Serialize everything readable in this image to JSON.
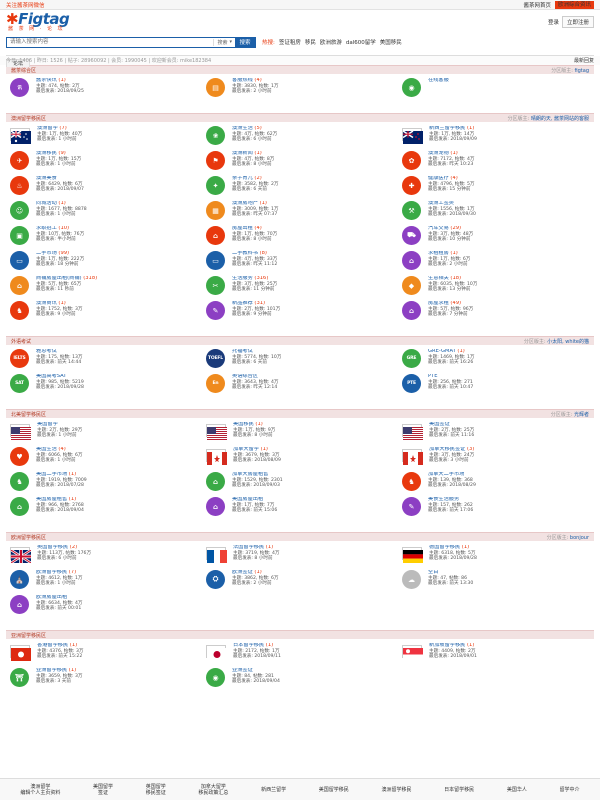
{
  "topbar": {
    "left": "关注酱茶网微信",
    "right_links": [
      "酱茶网首页",
      "欧洲综合资讯"
    ],
    "login": "立即注册"
  },
  "header": {
    "brand": "Figtag",
    "sub": "酱 茶 网 · 论 坛",
    "links": [
      "登录",
      "注册"
    ]
  },
  "search": {
    "placeholder": "请输入搜索内容",
    "select": "搜索",
    "button": "搜索",
    "hot_label": "热搜:",
    "hot": [
      "签证租房",
      "移民",
      "欧洲旅游",
      "dal600留学",
      "美国移民"
    ]
  },
  "nav": {
    "item": "论坛"
  },
  "stats": {
    "left": "今日: 1406 | 昨日: 1526 | 帖子: 28960092 | 会员: 1990045 | 欢迎新会员: mike182384",
    "right": "最新回复"
  },
  "colors": {
    "accent": "#e8380d",
    "brand": "#1b5fa8",
    "section": "#f2e2e2"
  },
  "sections": [
    {
      "title": "酱茶综合区",
      "mod": "分区版主: ",
      "mod_name": "figtag",
      "items": [
        {
          "icon": "ico-text",
          "bg": "#8c3fc3",
          "glyph": "讯",
          "name": "酱茶快讯",
          "count": "(1)",
          "l2": "主题: 474, 帖数: 2万",
          "l3": "最后发表: 2018/09/25"
        },
        {
          "icon": "ico",
          "bg": "#ef8a1d",
          "glyph": "▤",
          "name": "客服热线",
          "count": "(4)",
          "l2": "主题: 3830, 帖数: 1万",
          "l3": "最后发表: 2 小时前"
        },
        {
          "icon": "ico",
          "bg": "#3aaa46",
          "glyph": "◉",
          "name": "在线客服",
          "count": "",
          "l2": "",
          "l3": ""
        }
      ]
    },
    {
      "title": "澳洲留学移民区",
      "mod": "分区版主: ",
      "mod_name": "晴朗的天, 酱茶网站的客服",
      "items": [
        {
          "flag": "au",
          "name": "澳洲留学",
          "count": "(7)",
          "l2": "主题: 1万, 帖数: 40万",
          "l3": "最后发表: 1 小时前"
        },
        {
          "icon": "ico",
          "bg": "#3aaa46",
          "glyph": "❀",
          "name": "澳洲生活",
          "count": "(5)",
          "l2": "主题: 4万, 帖数: 62万",
          "l3": "最后发表: 6 小时前"
        },
        {
          "flag": "nz",
          "name": "新西兰留学移民",
          "count": "(1)",
          "l2": "主题: 1万, 帖数: 14万",
          "l3": "最后发表: 2018/09/09"
        },
        {
          "icon": "ico",
          "bg": "#e8380d",
          "glyph": "✈",
          "name": "澳洲移民",
          "count": "(9)",
          "l2": "主题: 1万, 帖数: 15万",
          "l3": "最后发表: 1 小时前"
        },
        {
          "icon": "ico",
          "bg": "#e8380d",
          "glyph": "⚑",
          "name": "澳洲新闻",
          "count": "(1)",
          "l2": "主题: 4万, 帖数: 8万",
          "l3": "最后发表: 8 小时前"
        },
        {
          "icon": "ico",
          "bg": "#e8380d",
          "glyph": "✿",
          "name": "澳洲宠物",
          "count": "(1)",
          "l2": "主题: 7172, 帖数: 4万",
          "l3": "最后发表: 昨天 10:23"
        },
        {
          "icon": "ico",
          "bg": "#e8380d",
          "glyph": "♨",
          "name": "澳洲美食",
          "count": "",
          "l2": "主题: 6429, 帖数: 6万",
          "l3": "最后发表: 2018/09/07"
        },
        {
          "icon": "ico",
          "bg": "#3aaa46",
          "glyph": "✦",
          "name": "亲子育儿",
          "count": "(2)",
          "l2": "主题: 3582, 帖数: 2万",
          "l3": "最后发表: 6 天前"
        },
        {
          "icon": "ico",
          "bg": "#e8380d",
          "glyph": "✚",
          "name": "健康医疗",
          "count": "(4)",
          "l2": "主题: 4796, 帖数: 5万",
          "l3": "最后发表: 15 分钟前"
        },
        {
          "icon": "ico",
          "bg": "#3aaa46",
          "glyph": "☺",
          "name": "同城活动",
          "count": "(1)",
          "l2": "主题: 1677, 帖数: 8878",
          "l3": "最后发表: 1 小时前"
        },
        {
          "icon": "ico",
          "bg": "#ef8a1d",
          "glyph": "▦",
          "name": "澳洲房地产",
          "count": "(1)",
          "l2": "主题: 3009, 帖数: 1万",
          "l3": "最后发表: 昨天 07:37"
        },
        {
          "icon": "ico",
          "bg": "#3aaa46",
          "glyph": "⚒",
          "name": "澳洲工签类",
          "count": "",
          "l2": "主题: 1556, 帖数: 1万",
          "l3": "最后发表: 2018/09/30"
        },
        {
          "icon": "ico",
          "bg": "#3aaa46",
          "glyph": "▣",
          "name": "求职招工",
          "count": "(10)",
          "l2": "主题: 10万, 帖数: 76万",
          "l3": "最后发表: 半小时前"
        },
        {
          "icon": "ico",
          "bg": "#e8380d",
          "glyph": "⌂",
          "name": "房屋出租",
          "count": "(4)",
          "l2": "主题: 1万, 帖数: 70万",
          "l3": "最后发表: 8 小时前"
        },
        {
          "icon": "ico",
          "bg": "#8c3fc3",
          "glyph": "⛟",
          "name": "汽车交易",
          "count": "(29)",
          "l2": "主题: 3万, 帖数: 48万",
          "l3": "最后发表: 10 分钟前"
        },
        {
          "icon": "ico",
          "bg": "#1b5fa8",
          "glyph": "▭",
          "name": "二手市场",
          "count": "(99)",
          "l2": "主题: 1万, 帖数: 222万",
          "l3": "最后发表: 18 分钟前"
        },
        {
          "icon": "ico",
          "bg": "#1b5fa8",
          "glyph": "▭",
          "name": "二手教科书",
          "count": "(8)",
          "l2": "主题: 4万, 帖数: 33万",
          "l3": "最后发表: 昨天 11:12"
        },
        {
          "icon": "ico",
          "bg": "#8c3fc3",
          "glyph": "⌂",
          "name": "求租租房",
          "count": "(1)",
          "l2": "主题: 1万, 帖数: 6万",
          "l3": "最后发表: 2 小时前"
        },
        {
          "icon": "ico",
          "bg": "#ef8a1d",
          "glyph": "⌂",
          "name": "商铺房屋出租(商铺)",
          "count": "(318)",
          "l2": "主题: 5万, 帖数: 65万",
          "l3": "最后发表: 11 秒前"
        },
        {
          "icon": "ico",
          "bg": "#3aaa46",
          "glyph": "✂",
          "name": "生活服务",
          "count": "(316)",
          "l2": "主题: 3万, 帖数: 25万",
          "l3": "最后发表: 11 分钟前"
        },
        {
          "icon": "ico",
          "bg": "#ef8a1d",
          "glyph": "◆",
          "name": "生意相关",
          "count": "(18)",
          "l2": "主题: 6035, 帖数: 10万",
          "l3": "最后发表: 13 分钟前"
        },
        {
          "icon": "ico",
          "bg": "#e8380d",
          "glyph": "♞",
          "name": "澳洲商讯",
          "count": "(1)",
          "l2": "主题: 1752, 帖数: 3万",
          "l3": "最后发表: 9 小时前"
        },
        {
          "icon": "ico",
          "bg": "#8c3fc3",
          "glyph": "✎",
          "name": "新品推荐",
          "count": "(31)",
          "l2": "主题: 2万, 帖数: 101万",
          "l3": "最后发表: 9 分钟前"
        },
        {
          "icon": "ico",
          "bg": "#8c3fc3",
          "glyph": "⌂",
          "name": "房屋求租",
          "count": "(49)",
          "l2": "主题: 5万, 帖数: 96万",
          "l3": "最后发表: 7 分钟前"
        }
      ]
    },
    {
      "title": "外语考试",
      "mod": "分区版主: ",
      "mod_name": "小太阳, white的猫",
      "items": [
        {
          "icon": "ico-text",
          "bg": "#e8380d",
          "glyph": "IELTS",
          "name": "雅思考试",
          "count": "",
          "l2": "主题: 175, 帖数: 13万",
          "l3": "最后发表: 前天 14:44"
        },
        {
          "icon": "ico-text",
          "bg": "#1a3a7a",
          "glyph": "TOEFL",
          "name": "托福考试",
          "count": "",
          "l2": "主题: 5774, 帖数: 10万",
          "l3": "最后发表: 6 天前"
        },
        {
          "icon": "ico-text",
          "bg": "#3aaa46",
          "glyph": "GRE",
          "name": "GRE-GMAT",
          "count": "(1)",
          "l2": "主题: 1469, 帖数: 1万",
          "l3": "最后发表: 前天 16:26"
        },
        {
          "icon": "ico-text",
          "bg": "#3aaa46",
          "glyph": "SAT",
          "name": "美国高考SAT",
          "count": "",
          "l2": "主题: 985, 帖数: 5219",
          "l3": "最后发表: 2018/09/28"
        },
        {
          "icon": "ico-text",
          "bg": "#ef8a1d",
          "glyph": "En",
          "name": "英语综合区",
          "count": "",
          "l2": "主题: 3643, 帖数: 4万",
          "l3": "最后发表: 昨天 12:14"
        },
        {
          "icon": "ico-text",
          "bg": "#1b5fa8",
          "glyph": "PTE",
          "name": "PTE",
          "count": "",
          "l2": "主题: 256, 帖数: 271",
          "l3": "最后发表: 前天 10:47"
        }
      ]
    },
    {
      "title": "北美留学移民区",
      "mod": "分区版主: ",
      "mod_name": "光辉者",
      "items": [
        {
          "flag": "us",
          "name": "美国留学",
          "count": "",
          "l2": "主题: 2万, 帖数: 29万",
          "l3": "最后发表: 1 小时前"
        },
        {
          "flag": "us",
          "name": "美国移民",
          "count": "(1)",
          "l2": "主题: 1万, 帖数: 9万",
          "l3": "最后发表: 8 小时前"
        },
        {
          "flag": "us",
          "name": "美国签证",
          "count": "",
          "l2": "主题: 2万, 帖数: 25万",
          "l3": "最后发表: 前天 11:16"
        },
        {
          "icon": "ico",
          "bg": "#e8380d",
          "glyph": "♥",
          "name": "美国生活",
          "count": "(4)",
          "l2": "主题: 6066, 帖数: 6万",
          "l3": "最后发表: 1 小时前"
        },
        {
          "flag": "ca",
          "name": "加拿大留学",
          "count": "(1)",
          "l2": "主题: 3679, 帖数: 3万",
          "l3": "最后发表: 2018/08/09"
        },
        {
          "flag": "ca",
          "name": "加拿大移民签证",
          "count": "(3)",
          "l2": "主题: 3万, 帖数: 24万",
          "l3": "最后发表: 3 小时前"
        },
        {
          "icon": "ico",
          "bg": "#3aaa46",
          "glyph": "♞",
          "name": "美国二手市场",
          "count": "(1)",
          "l2": "主题: 1919, 帖数: 7009",
          "l3": "最后发表: 2018/07/28"
        },
        {
          "icon": "ico",
          "bg": "#3aaa46",
          "glyph": "⌂",
          "name": "加拿大房屋租售",
          "count": "",
          "l2": "主题: 1529, 帖数: 2301",
          "l3": "最后发表: 2018/09/03"
        },
        {
          "icon": "ico",
          "bg": "#e8380d",
          "glyph": "♞",
          "name": "加拿大二手市场",
          "count": "",
          "l2": "主题: 139, 帖数: 368",
          "l3": "最后发表: 2018/08/29"
        },
        {
          "icon": "ico",
          "bg": "#3aaa46",
          "glyph": "⌂",
          "name": "美国房屋租售",
          "count": "(1)",
          "l2": "主题: 966, 帖数: 2768",
          "l3": "最后发表: 2018/09/04"
        },
        {
          "icon": "ico",
          "bg": "#8c3fc3",
          "glyph": "⌂",
          "name": "美国房屋出租",
          "count": "",
          "l2": "主题: 1万, 帖数: 7万",
          "l3": "最后发表: 前天 15:06"
        },
        {
          "icon": "ico",
          "bg": "#8c3fc3",
          "glyph": "✎",
          "name": "美食生活服务",
          "count": "",
          "l2": "主题: 157, 帖数: 262",
          "l3": "最后发表: 前天 17:06"
        }
      ]
    },
    {
      "title": "欧洲留学移民区",
      "mod": "分区版主: ",
      "mod_name": "bonjour",
      "items": [
        {
          "flag": "uk",
          "name": "英国留学移民",
          "count": "(2)",
          "l2": "主题: 113万, 帖数: 176万",
          "l3": "最后发表: 6 小时前"
        },
        {
          "flag": "fr",
          "name": "法国留学移民",
          "count": "(1)",
          "l2": "主题: 3719, 帖数: 4万",
          "l3": "最后发表: 8 小时前"
        },
        {
          "flag": "de",
          "name": "德国留学移民",
          "count": "(1)",
          "l2": "主题: 6318, 帖数: 5万",
          "l3": "最后发表: 2018/09/28"
        },
        {
          "icon": "ico",
          "bg": "#1b5fa8",
          "glyph": "⛪",
          "name": "欧洲留学移民",
          "count": "(7)",
          "l2": "主题: 4612, 帖数: 1万",
          "l3": "最后发表: 1 小时前"
        },
        {
          "icon": "ico",
          "bg": "#1b5fa8",
          "glyph": "⛭",
          "name": "欧洲签证",
          "count": "(1)",
          "l2": "主题: 3862, 帖数: 6万",
          "l3": "最后发表: 2 小时前"
        },
        {
          "icon": "ico",
          "bg": "#bbbbbb",
          "glyph": "☁",
          "name": "空白",
          "count": "",
          "l2": "主题: 47, 帖数: 86",
          "l3": "最后发表: 前天 13:30"
        },
        {
          "icon": "ico",
          "bg": "#8c3fc3",
          "glyph": "⌂",
          "name": "欧洲房屋出租",
          "count": "",
          "l2": "主题: 6634, 帖数: 4万",
          "l3": "最后发表: 前天 00:01"
        }
      ]
    },
    {
      "title": "亚洲留学移民区",
      "mod": "",
      "mod_name": "",
      "items": [
        {
          "flag": "hk",
          "name": "香港留学移民",
          "count": "(1)",
          "l2": "主题: 4376, 帖数: 3万",
          "l3": "最后发表: 前天 15:22"
        },
        {
          "flag": "jp",
          "name": "日本留学移民",
          "count": "(1)",
          "l2": "主题: 2172, 帖数: 1万",
          "l3": "最后发表: 2018/09/11"
        },
        {
          "flag": "sg",
          "name": "新加坡留学移民",
          "count": "(1)",
          "l2": "主题: 4409, 帖数: 2万",
          "l3": "最后发表: 2018/09/01"
        },
        {
          "icon": "ico",
          "bg": "#3aaa46",
          "glyph": "⛩",
          "name": "亚洲留学移民",
          "count": "(1)",
          "l2": "主题: 3659, 帖数: 3万",
          "l3": "最后发表: 3 天前"
        },
        {
          "icon": "ico",
          "bg": "#3aaa46",
          "glyph": "◉",
          "name": "亚洲签证",
          "count": "",
          "l2": "主题: 84, 帖数: 281",
          "l3": "最后发表: 2018/09/04"
        }
      ]
    }
  ],
  "footer": [
    [
      "澳洲留学",
      "编辑个人主页资料"
    ],
    [
      "美国留学",
      "签证"
    ],
    [
      "英国留学",
      "移民签证"
    ],
    [
      "加拿大留学",
      "移民政策汇总"
    ],
    [
      "新西兰留学"
    ],
    [
      "美国留学移民"
    ],
    [
      "澳洲留学移民"
    ],
    [
      "日本留学移民"
    ],
    [
      "美国华人"
    ],
    [
      "留学中介"
    ]
  ]
}
